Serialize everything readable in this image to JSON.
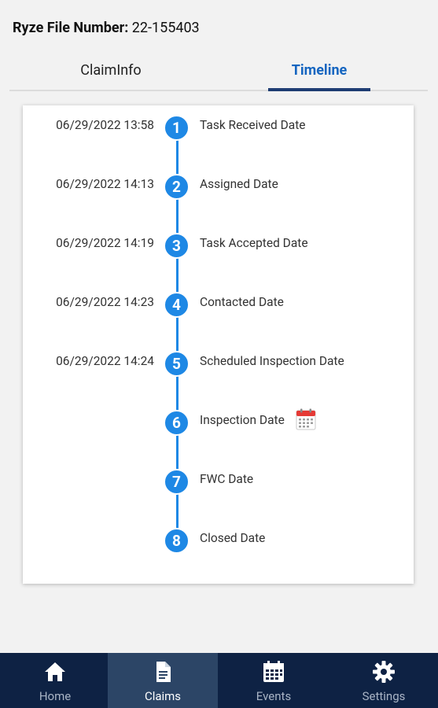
{
  "header": {
    "file_number_label": "Ryze File Number:",
    "file_number_value": "22-155403"
  },
  "tabs": [
    {
      "label": "ClaimInfo",
      "active": false
    },
    {
      "label": "Timeline",
      "active": true
    }
  ],
  "timeline": {
    "steps": [
      {
        "number": "1",
        "date": "06/29/2022 13:58",
        "label": "Task Received Date"
      },
      {
        "number": "2",
        "date": "06/29/2022 14:13",
        "label": "Assigned Date"
      },
      {
        "number": "3",
        "date": "06/29/2022 14:19",
        "label": "Task Accepted Date"
      },
      {
        "number": "4",
        "date": "06/29/2022 14:23",
        "label": "Contacted Date"
      },
      {
        "number": "5",
        "date": "06/29/2022 14:24",
        "label": "Scheduled Inspection Date"
      },
      {
        "number": "6",
        "date": "",
        "label": "Inspection Date"
      },
      {
        "number": "7",
        "date": "",
        "label": "FWC Date"
      },
      {
        "number": "8",
        "date": "",
        "label": "Closed Date"
      }
    ],
    "accent_color": "#1e88e5"
  },
  "bottom_nav": {
    "items": [
      {
        "label": "Home",
        "icon": "home-icon",
        "active": false
      },
      {
        "label": "Claims",
        "icon": "document-icon",
        "active": true
      },
      {
        "label": "Events",
        "icon": "calendar-icon",
        "active": false
      },
      {
        "label": "Settings",
        "icon": "gear-icon",
        "active": false
      }
    ],
    "background": "#0e2244"
  }
}
